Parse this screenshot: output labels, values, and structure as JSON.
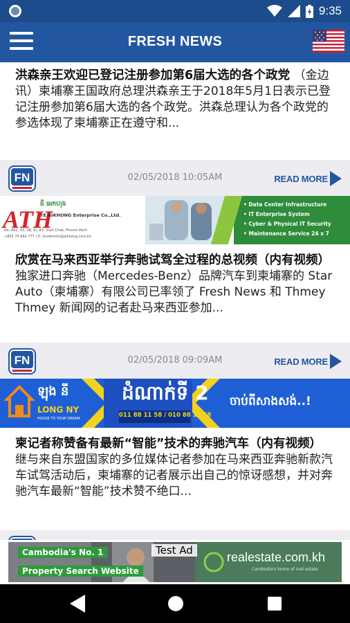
{
  "status_bar": {
    "time": "9:35"
  },
  "app_bar": {
    "title": "FRESH NEWS"
  },
  "articles": [
    {
      "headline": "洪森亲王欢迎已登记注册参加第6届大选的各个政党",
      "summary": " （金边讯）柬埔寨王国政府总理洪森亲王于2018年5月1日表示已登记注册参加第6届大选的各个政党。洪森总理认为各个政党的参选体现了柬埔寨正在遵守和...",
      "timestamp": "02/05/2018 10:05AM",
      "read_more": "READ MORE"
    },
    {
      "headline": "欣赏在马来西亚举行奔驰试驾全过程的总视频（内有视频）",
      "summary": " 独家进口奔驰（Mercedes-Benz）品牌汽车到柬埔寨的 Star Auto（柬埔寨）有限公司已率领了 Fresh News 和 Thmey Thmey 新闻网的记者赴马来西亚参加...",
      "timestamp": "02/05/2018 09:09AM",
      "read_more": "READ MORE"
    },
    {
      "headline": "柬记者称赞备有最新“智能”技术的奔驰汽车（内有视频）",
      "summary": " 继与来自东盟国家的多位媒体记者参加在马来西亚奔驰新款汽车试驾活动后，柬埔寨的记者展示出自己的惊讶感想，并对奔驰汽车最新“智能”技术赞不绝口...",
      "timestamp": "",
      "read_more": ""
    }
  ],
  "banner_ath": {
    "logo": "ATH",
    "khmer_name": "ធី អេកហុង",
    "company": "TE AIKHONG Enterprise Co.,Ltd.",
    "address": "No. A82, 03, 3B, St. R3, Srah Chak, Phnom Penh",
    "contact": "+855 70 662 777 | E: showroom@aikhong.com.kh",
    "services": [
      "Data Center Infrastructure",
      "IT Enterprise System",
      "Cyber & Physical IT Security",
      "Maintenance Service 24 x 7"
    ]
  },
  "banner_longny": {
    "brand_khmer": "ឡុង នី",
    "brand": "LONG NY",
    "tagline": "HOUSE TO YOUR DREAM",
    "stage": "ដំណាក់ទី 2",
    "phones": "011 88 11 58 / 010 88 11 58",
    "cta": "ចាប់ពីសាងសង់..!"
  },
  "ad": {
    "line1": "Cambodia's No. 1",
    "line2": "Property Search Website",
    "test_label": "Test Ad",
    "brand": "realestate.com.kh",
    "brand_tagline": "Cambodia's home of real estate"
  },
  "colors": {
    "app_bar": "#2356a0",
    "status_bar": "#1d4c8c",
    "accent": "#2356a0",
    "ad_green": "#2e9b3a"
  }
}
